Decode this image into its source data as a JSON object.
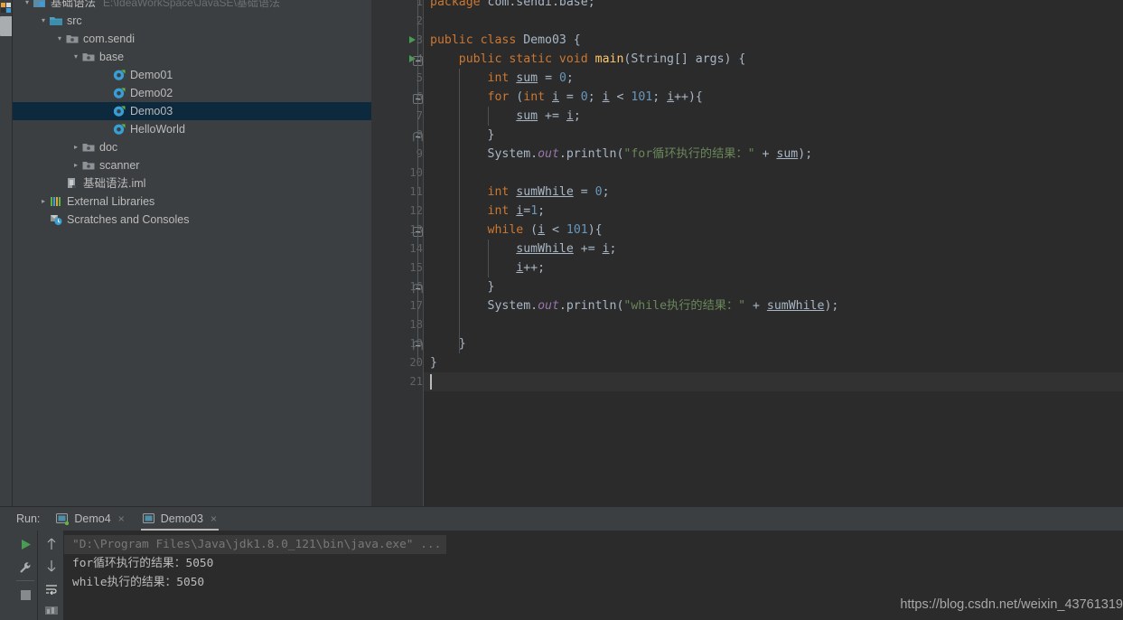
{
  "window": {
    "theme_bg": "#3c3f41",
    "editor_bg": "#2b2b2b",
    "gutter_bg": "#313335",
    "selection_bg": "#0d293e",
    "accent_green": "#499c54"
  },
  "sidebar": {
    "project_root": {
      "label": "基础语法",
      "path": "E:\\IdeaWorkSpace\\JavaSE\\基础语法",
      "icon": "module-icon",
      "expanded": true
    },
    "items": [
      {
        "label": "src",
        "icon": "source-folder-icon",
        "indent": 1,
        "arrow": "expanded",
        "selected": false
      },
      {
        "label": "com.sendi",
        "icon": "package-icon",
        "indent": 2,
        "arrow": "expanded",
        "selected": false
      },
      {
        "label": "base",
        "icon": "package-icon",
        "indent": 3,
        "arrow": "expanded",
        "selected": false
      },
      {
        "label": "Demo01",
        "icon": "java-class-icon",
        "indent": 4,
        "arrow": "none",
        "selected": false
      },
      {
        "label": "Demo02",
        "icon": "java-class-icon",
        "indent": 4,
        "arrow": "none",
        "selected": false
      },
      {
        "label": "Demo03",
        "icon": "java-class-icon",
        "indent": 4,
        "arrow": "none",
        "selected": true
      },
      {
        "label": "HelloWorld",
        "icon": "java-class-icon",
        "indent": 4,
        "arrow": "none",
        "selected": false
      },
      {
        "label": "doc",
        "icon": "package-icon",
        "indent": 3,
        "arrow": "collapsed",
        "selected": false
      },
      {
        "label": "scanner",
        "icon": "package-icon",
        "indent": 3,
        "arrow": "collapsed",
        "selected": false
      },
      {
        "label": "基础语法.iml",
        "icon": "iml-file-icon",
        "indent": 2,
        "arrow": "none",
        "selected": false
      },
      {
        "label": "External Libraries",
        "icon": "libraries-icon",
        "indent": 1,
        "arrow": "collapsed",
        "selected": false
      },
      {
        "label": "Scratches and Consoles",
        "icon": "scratches-icon",
        "indent": 1,
        "arrow": "none",
        "selected": false
      }
    ]
  },
  "editor": {
    "file": "Demo03.java",
    "total_lines": 21,
    "caret_line": 21,
    "lines": [
      {
        "n": 1,
        "runmark": false,
        "fold": "none",
        "tokens": [
          {
            "t": "package ",
            "c": "kw"
          },
          {
            "t": "com.sendi.base",
            "c": "plain"
          },
          {
            "t": ";",
            "c": "plain"
          }
        ],
        "indent": 0
      },
      {
        "n": 2,
        "runmark": false,
        "fold": "none",
        "tokens": [],
        "indent": 0
      },
      {
        "n": 3,
        "runmark": true,
        "fold": "none",
        "tokens": [
          {
            "t": "public ",
            "c": "kw"
          },
          {
            "t": "class ",
            "c": "kw"
          },
          {
            "t": "Demo03",
            "c": "cls"
          },
          {
            "t": " {",
            "c": "plain"
          }
        ],
        "indent": 0
      },
      {
        "n": 4,
        "runmark": true,
        "fold": "start",
        "tokens": [
          {
            "t": "    ",
            "c": "plain"
          },
          {
            "t": "public ",
            "c": "kw"
          },
          {
            "t": "static ",
            "c": "kw"
          },
          {
            "t": "void ",
            "c": "kw"
          },
          {
            "t": "main",
            "c": "mth"
          },
          {
            "t": "(String[] args) {",
            "c": "plain"
          }
        ],
        "indent": 1
      },
      {
        "n": 5,
        "runmark": false,
        "fold": "none",
        "tokens": [
          {
            "t": "        ",
            "c": "plain"
          },
          {
            "t": "int ",
            "c": "kw"
          },
          {
            "t": "sum",
            "c": "var"
          },
          {
            "t": " = ",
            "c": "plain"
          },
          {
            "t": "0",
            "c": "num"
          },
          {
            "t": ";",
            "c": "plain"
          }
        ],
        "indent": 2
      },
      {
        "n": 6,
        "runmark": false,
        "fold": "start",
        "tokens": [
          {
            "t": "        ",
            "c": "plain"
          },
          {
            "t": "for ",
            "c": "kw"
          },
          {
            "t": "(",
            "c": "plain"
          },
          {
            "t": "int ",
            "c": "kw"
          },
          {
            "t": "i",
            "c": "var"
          },
          {
            "t": " = ",
            "c": "plain"
          },
          {
            "t": "0",
            "c": "num"
          },
          {
            "t": "; ",
            "c": "plain"
          },
          {
            "t": "i",
            "c": "var"
          },
          {
            "t": " < ",
            "c": "plain"
          },
          {
            "t": "101",
            "c": "num"
          },
          {
            "t": "; ",
            "c": "plain"
          },
          {
            "t": "i",
            "c": "var"
          },
          {
            "t": "++){",
            "c": "plain"
          }
        ],
        "indent": 2
      },
      {
        "n": 7,
        "runmark": false,
        "fold": "none",
        "tokens": [
          {
            "t": "            ",
            "c": "plain"
          },
          {
            "t": "sum",
            "c": "var"
          },
          {
            "t": " += ",
            "c": "plain"
          },
          {
            "t": "i",
            "c": "var"
          },
          {
            "t": ";",
            "c": "plain"
          }
        ],
        "indent": 3
      },
      {
        "n": 8,
        "runmark": false,
        "fold": "end",
        "tokens": [
          {
            "t": "        }",
            "c": "plain"
          }
        ],
        "indent": 2
      },
      {
        "n": 9,
        "runmark": false,
        "fold": "none",
        "tokens": [
          {
            "t": "        System.",
            "c": "plain"
          },
          {
            "t": "out",
            "c": "fld"
          },
          {
            "t": ".println(",
            "c": "plain"
          },
          {
            "t": "\"for循环执行的结果：\"",
            "c": "str"
          },
          {
            "t": " + ",
            "c": "plain"
          },
          {
            "t": "sum",
            "c": "var"
          },
          {
            "t": ");",
            "c": "plain"
          }
        ],
        "indent": 2
      },
      {
        "n": 10,
        "runmark": false,
        "fold": "none",
        "tokens": [],
        "indent": 2
      },
      {
        "n": 11,
        "runmark": false,
        "fold": "none",
        "tokens": [
          {
            "t": "        ",
            "c": "plain"
          },
          {
            "t": "int ",
            "c": "kw"
          },
          {
            "t": "sumWhile",
            "c": "var"
          },
          {
            "t": " = ",
            "c": "plain"
          },
          {
            "t": "0",
            "c": "num"
          },
          {
            "t": ";",
            "c": "plain"
          }
        ],
        "indent": 2
      },
      {
        "n": 12,
        "runmark": false,
        "fold": "none",
        "tokens": [
          {
            "t": "        ",
            "c": "plain"
          },
          {
            "t": "int ",
            "c": "kw"
          },
          {
            "t": "i",
            "c": "var"
          },
          {
            "t": "=",
            "c": "plain"
          },
          {
            "t": "1",
            "c": "num"
          },
          {
            "t": ";",
            "c": "plain"
          }
        ],
        "indent": 2
      },
      {
        "n": 13,
        "runmark": false,
        "fold": "start",
        "tokens": [
          {
            "t": "        ",
            "c": "plain"
          },
          {
            "t": "while ",
            "c": "kw"
          },
          {
            "t": "(",
            "c": "plain"
          },
          {
            "t": "i",
            "c": "var"
          },
          {
            "t": " < ",
            "c": "plain"
          },
          {
            "t": "101",
            "c": "num"
          },
          {
            "t": "){",
            "c": "plain"
          }
        ],
        "indent": 2
      },
      {
        "n": 14,
        "runmark": false,
        "fold": "none",
        "tokens": [
          {
            "t": "            ",
            "c": "plain"
          },
          {
            "t": "sumWhile",
            "c": "var"
          },
          {
            "t": " += ",
            "c": "plain"
          },
          {
            "t": "i",
            "c": "var"
          },
          {
            "t": ";",
            "c": "plain"
          }
        ],
        "indent": 3
      },
      {
        "n": 15,
        "runmark": false,
        "fold": "none",
        "tokens": [
          {
            "t": "            ",
            "c": "plain"
          },
          {
            "t": "i",
            "c": "var"
          },
          {
            "t": "++;",
            "c": "plain"
          }
        ],
        "indent": 3
      },
      {
        "n": 16,
        "runmark": false,
        "fold": "end",
        "tokens": [
          {
            "t": "        }",
            "c": "plain"
          }
        ],
        "indent": 2
      },
      {
        "n": 17,
        "runmark": false,
        "fold": "none",
        "tokens": [
          {
            "t": "        System.",
            "c": "plain"
          },
          {
            "t": "out",
            "c": "fld"
          },
          {
            "t": ".println(",
            "c": "plain"
          },
          {
            "t": "\"while执行的结果：\"",
            "c": "str"
          },
          {
            "t": " + ",
            "c": "plain"
          },
          {
            "t": "sumWhile",
            "c": "var"
          },
          {
            "t": ");",
            "c": "plain"
          }
        ],
        "indent": 2
      },
      {
        "n": 18,
        "runmark": false,
        "fold": "none",
        "tokens": [],
        "indent": 2
      },
      {
        "n": 19,
        "runmark": false,
        "fold": "end",
        "tokens": [
          {
            "t": "    }",
            "c": "plain"
          }
        ],
        "indent": 1
      },
      {
        "n": 20,
        "runmark": false,
        "fold": "none",
        "tokens": [
          {
            "t": "}",
            "c": "plain"
          }
        ],
        "indent": 0
      },
      {
        "n": 21,
        "runmark": false,
        "fold": "none",
        "tokens": [],
        "indent": 0
      }
    ]
  },
  "run_panel": {
    "title": "Run:",
    "tabs": [
      {
        "label": "Demo4",
        "active": false,
        "running": true,
        "close": "×"
      },
      {
        "label": "Demo03",
        "active": true,
        "running": false,
        "close": "×"
      }
    ],
    "toolbar_left": [
      "rerun-icon",
      "settings-wrench-icon",
      "stop-icon"
    ],
    "toolbar_right": [
      "up-arrow-icon",
      "down-arrow-icon",
      "soft-wrap-icon",
      "print-icon"
    ],
    "console_lines": [
      {
        "text": "\"D:\\Program Files\\Java\\jdk1.8.0_121\\bin\\java.exe\" ...",
        "style": "cmd"
      },
      {
        "text": "for循环执行的结果：5050",
        "style": "out"
      },
      {
        "text": "while执行的结果：5050",
        "style": "out"
      },
      {
        "text": "",
        "style": "out"
      }
    ]
  },
  "watermark": {
    "text": "https://blog.csdn.net/weixin_43761319"
  }
}
